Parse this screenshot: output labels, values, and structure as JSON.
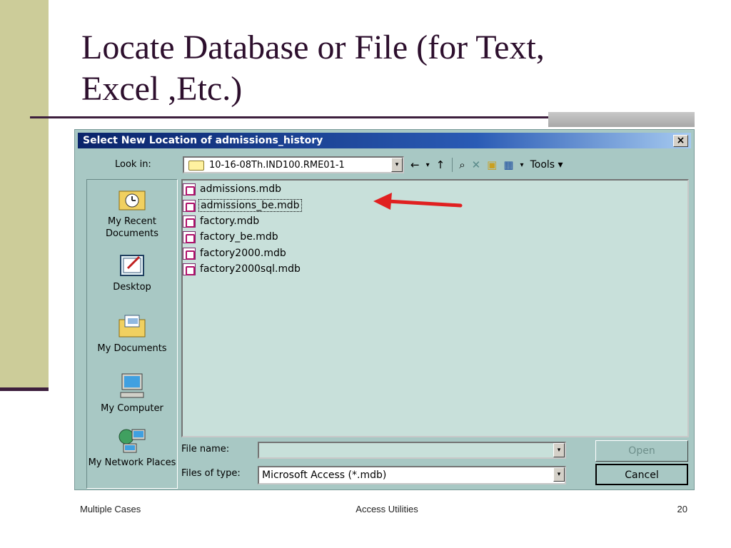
{
  "slide": {
    "title_line1": "Locate Database or File (for Text,",
    "title_line2": "Excel ,Etc.)",
    "footer_left": "Multiple Cases",
    "footer_center": "Access Utilities",
    "footer_right": "20"
  },
  "dialog": {
    "title": "Select New Location of admissions_history",
    "close_label": "×",
    "look_in_label": "Look in:",
    "look_in_value": "10-16-08Th.IND100.RME01-1",
    "toolbar": {
      "back_icon": "←",
      "up_icon": "↑",
      "search_icon": "⌕",
      "delete_icon": "✕",
      "new_folder_icon": "▣",
      "views_icon": "▦",
      "dropdown_icon": "▾",
      "tools_label": "Tools ▾"
    },
    "places": [
      {
        "label": "My Recent Documents"
      },
      {
        "label": "Desktop"
      },
      {
        "label": "My Documents"
      },
      {
        "label": "My Computer"
      },
      {
        "label": "My Network Places"
      }
    ],
    "files": [
      {
        "name": "admissions.mdb"
      },
      {
        "name": "admissions_be.mdb"
      },
      {
        "name": "factory.mdb"
      },
      {
        "name": "factory_be.mdb"
      },
      {
        "name": "factory2000.mdb"
      },
      {
        "name": "factory2000sql.mdb"
      }
    ],
    "file_name_label": "File name:",
    "file_name_value": "",
    "files_of_type_label": "Files of type:",
    "files_of_type_value": "Microsoft Access (*.mdb)",
    "open_label": "Open",
    "cancel_label": "Cancel"
  }
}
